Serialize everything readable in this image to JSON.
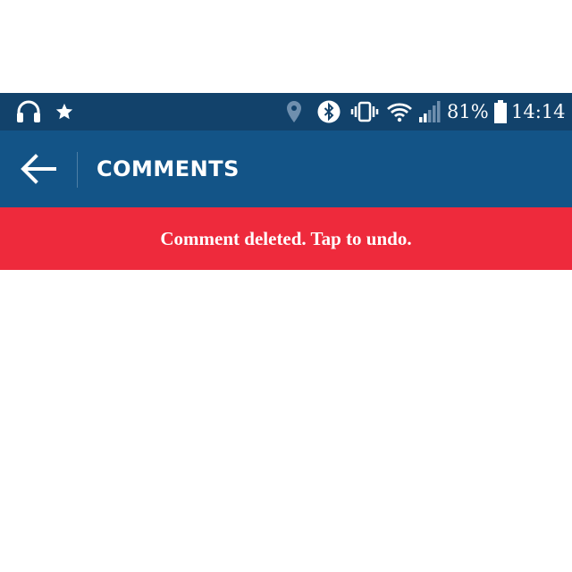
{
  "status_bar": {
    "battery_percent": "81%",
    "time": "14:14",
    "icons": [
      "headphones-icon",
      "star-icon",
      "location-icon",
      "bluetooth-icon",
      "vibrate-icon",
      "wifi-icon",
      "signal-icon",
      "battery-icon"
    ]
  },
  "app_bar": {
    "title": "COMMENTS",
    "back_icon": "back-arrow-icon"
  },
  "snackbar": {
    "message": "Comment deleted. Tap to undo."
  },
  "colors": {
    "status_bar_bg": "#12426b",
    "app_bar_bg": "#135487",
    "snackbar_bg": "#ee2a3c",
    "content_bg": "#ffffff"
  }
}
